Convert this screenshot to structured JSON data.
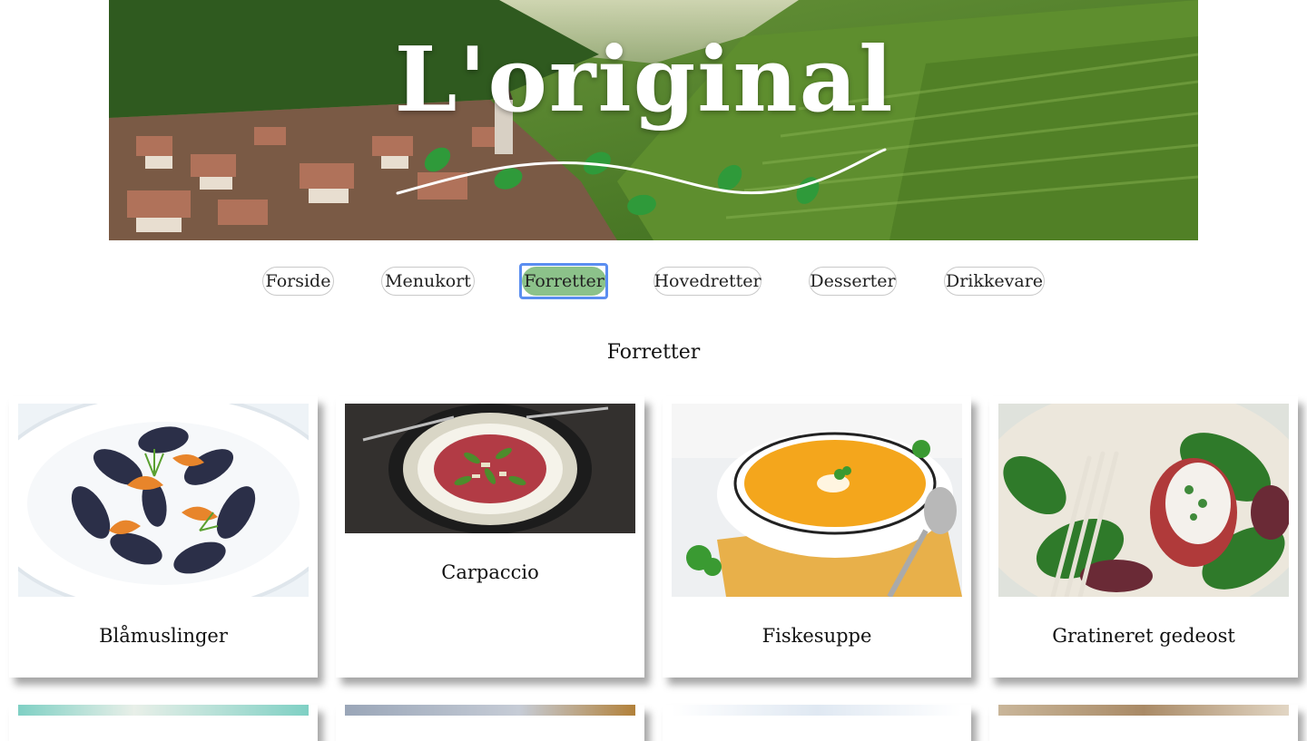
{
  "banner": {
    "logo": "L'original"
  },
  "nav": {
    "items": [
      {
        "label": "Forside"
      },
      {
        "label": "Menukort"
      },
      {
        "label": "Forretter"
      },
      {
        "label": "Hovedretter"
      },
      {
        "label": "Desserter"
      },
      {
        "label": "Drikkevare"
      }
    ],
    "active": "Forretter"
  },
  "page": {
    "title": "Forretter"
  },
  "cards": [
    {
      "name": "Blåmuslinger",
      "image": "mussels-dish-image"
    },
    {
      "name": "Carpaccio",
      "image": "carpaccio-plate-image"
    },
    {
      "name": "Fiskesuppe",
      "image": "fish-soup-bowl-image"
    },
    {
      "name": "Gratineret gedeost",
      "image": "goat-cheese-salad-image"
    }
  ],
  "colors": {
    "active_nav": "#8cc28a",
    "focus_ring": "#5b8ef0"
  }
}
